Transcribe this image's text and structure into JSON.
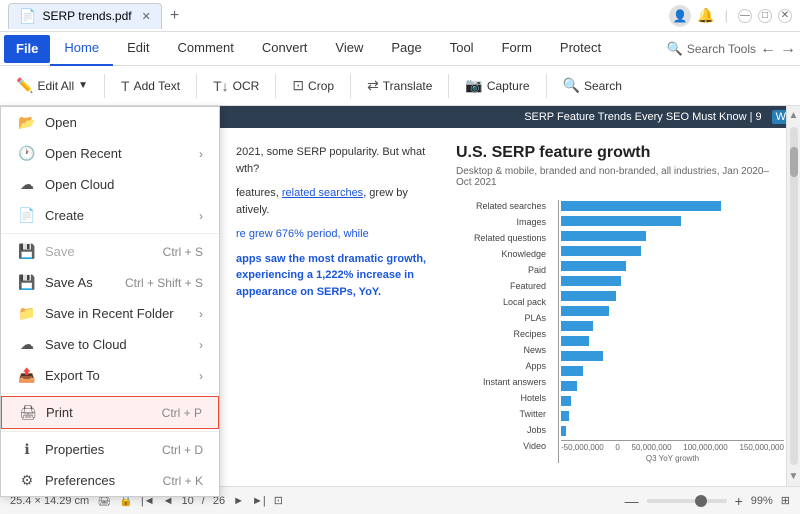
{
  "titlebar": {
    "tab_name": "SERP trends.pdf",
    "close_icon": "✕",
    "new_tab_icon": "+",
    "profile_icon": "👤",
    "minimize_icon": "—",
    "maximize_icon": "□",
    "winclose_icon": "✕"
  },
  "menubar": {
    "file_label": "File",
    "tabs": [
      "Home",
      "Edit",
      "Comment",
      "Convert",
      "View",
      "Page",
      "Tool",
      "Form",
      "Protect"
    ]
  },
  "toolbar": {
    "edit_all": "Edit All",
    "add_text": "Add Text",
    "ocr": "OCR",
    "crop": "Crop",
    "translate": "Translate",
    "capture": "Capture",
    "search": "Search",
    "search_tools": "Search Tools"
  },
  "dropdown": {
    "items": [
      {
        "id": "open",
        "icon": "📂",
        "label": "Open",
        "shortcut": "",
        "arrow": ""
      },
      {
        "id": "open_recent",
        "icon": "🕐",
        "label": "Open Recent",
        "shortcut": "",
        "arrow": "›"
      },
      {
        "id": "open_cloud",
        "icon": "☁",
        "label": "Open Cloud",
        "shortcut": "",
        "arrow": ""
      },
      {
        "id": "create",
        "icon": "📄",
        "label": "Create",
        "shortcut": "",
        "arrow": "›"
      },
      {
        "id": "sep1",
        "type": "separator"
      },
      {
        "id": "save",
        "icon": "💾",
        "label": "Save",
        "shortcut": "Ctrl + S",
        "arrow": "",
        "disabled": true
      },
      {
        "id": "save_as",
        "icon": "💾",
        "label": "Save As",
        "shortcut": "Ctrl + Shift + S",
        "arrow": ""
      },
      {
        "id": "save_recent",
        "icon": "📁",
        "label": "Save in Recent Folder",
        "shortcut": "",
        "arrow": "›"
      },
      {
        "id": "save_cloud",
        "icon": "☁",
        "label": "Save to Cloud",
        "shortcut": "",
        "arrow": "›"
      },
      {
        "id": "export",
        "icon": "📤",
        "label": "Export To",
        "shortcut": "",
        "arrow": "›"
      },
      {
        "id": "sep2",
        "type": "separator"
      },
      {
        "id": "print",
        "icon": "🖨",
        "label": "Print",
        "shortcut": "Ctrl + P",
        "arrow": "",
        "highlighted": true
      },
      {
        "id": "sep3",
        "type": "separator"
      },
      {
        "id": "properties",
        "icon": "ℹ",
        "label": "Properties",
        "shortcut": "Ctrl + D",
        "arrow": ""
      },
      {
        "id": "preferences",
        "icon": "⚙",
        "label": "Preferences",
        "shortcut": "Ctrl + K",
        "arrow": ""
      }
    ]
  },
  "pdf": {
    "header": "SERP Feature Trends Every SEO Must Know | 9",
    "title": "U.S. SERP feature growth",
    "subtitle": "Desktop & mobile, branded and non-branded, all industries, Jan 2020–Oct 2021",
    "body_text_1": "2021, some SERP popularity. But what wth?",
    "body_text_2": "features, related searches, grew by atively.",
    "highlight_text": "re grew 676% period, while",
    "highlight_bold": "apps saw the most dramatic growth, experiencing a 1,222% increase in appearance on SERPs, YoY.",
    "chart_labels": [
      "Related searches",
      "Images",
      "Related questions",
      "Knowledge",
      "Paid",
      "Featured",
      "Local pack",
      "PLAs",
      "Recipes",
      "News",
      "Apps",
      "Instant answers",
      "Hotels",
      "Twitter",
      "Jobs",
      "Video"
    ],
    "chart_x_labels": [
      "-50,000,000",
      "0",
      "50,000,000",
      "100,000,000",
      "150,000,000"
    ],
    "chart_x_axis_label": "Q3 YoY growth",
    "chart_bars": [
      150,
      120,
      80,
      75,
      60,
      55,
      50,
      45,
      30,
      25,
      40,
      20,
      15,
      10,
      8,
      5
    ]
  },
  "statusbar": {
    "dimensions": "25.4 × 14.29 cm",
    "page_info": "10 / 26",
    "zoom": "99%",
    "zoom_minus": "—",
    "zoom_plus": "+"
  }
}
